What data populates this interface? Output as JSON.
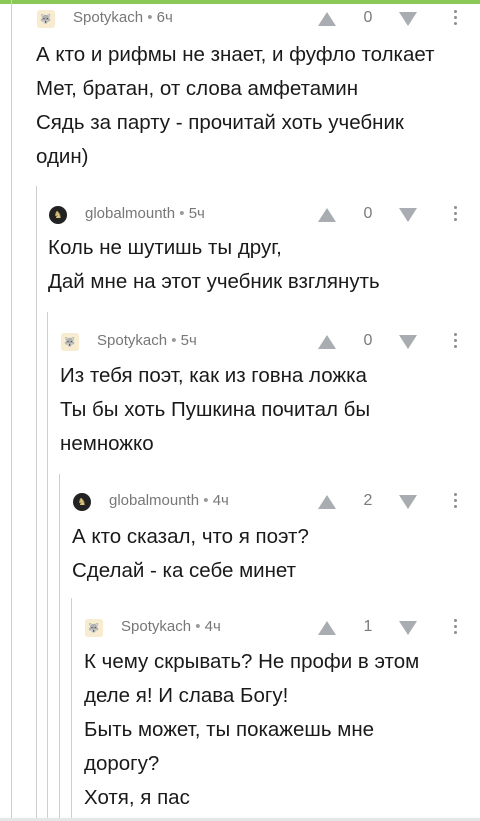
{
  "comments": [
    {
      "author": "Spotykach",
      "age": "6ч",
      "score": "0",
      "avatar_icon": "wolf-avatar-icon",
      "lines": [
        "А кто и рифмы не знает, и фуфло толкает",
        "Мет, братан, от слова амфетамин",
        "Сядь за парту - прочитай хоть учебник",
        "один)"
      ]
    },
    {
      "author": "globalmounth",
      "age": "5ч",
      "score": "0",
      "avatar_icon": "dark-round-avatar-icon",
      "lines": [
        "Коль не шутишь ты друг,",
        "Дай мне на этот учебник взглянуть"
      ]
    },
    {
      "author": "Spotykach",
      "age": "5ч",
      "score": "0",
      "avatar_icon": "wolf-avatar-icon",
      "lines": [
        "Из тебя поэт, как из говна ложка",
        "Ты бы хоть Пушкина почитал бы",
        "немножко"
      ]
    },
    {
      "author": "globalmounth",
      "age": "4ч",
      "score": "2",
      "avatar_icon": "dark-round-avatar-icon",
      "lines": [
        "А кто сказал, что я поэт?",
        "Сделай - ка себе минет"
      ]
    },
    {
      "author": "Spotykach",
      "age": "4ч",
      "score": "1",
      "avatar_icon": "wolf-avatar-icon",
      "lines": [
        "К чему скрывать? Не профи в этом",
        "деле я! И слава Богу!",
        "Быть может, ты покажешь мне",
        "дорогу?",
        "Хотя, я пас"
      ]
    }
  ],
  "separator": "•",
  "colors": {
    "accent": "#8ac858",
    "vote": "#a9acb1",
    "meta": "#777777"
  }
}
